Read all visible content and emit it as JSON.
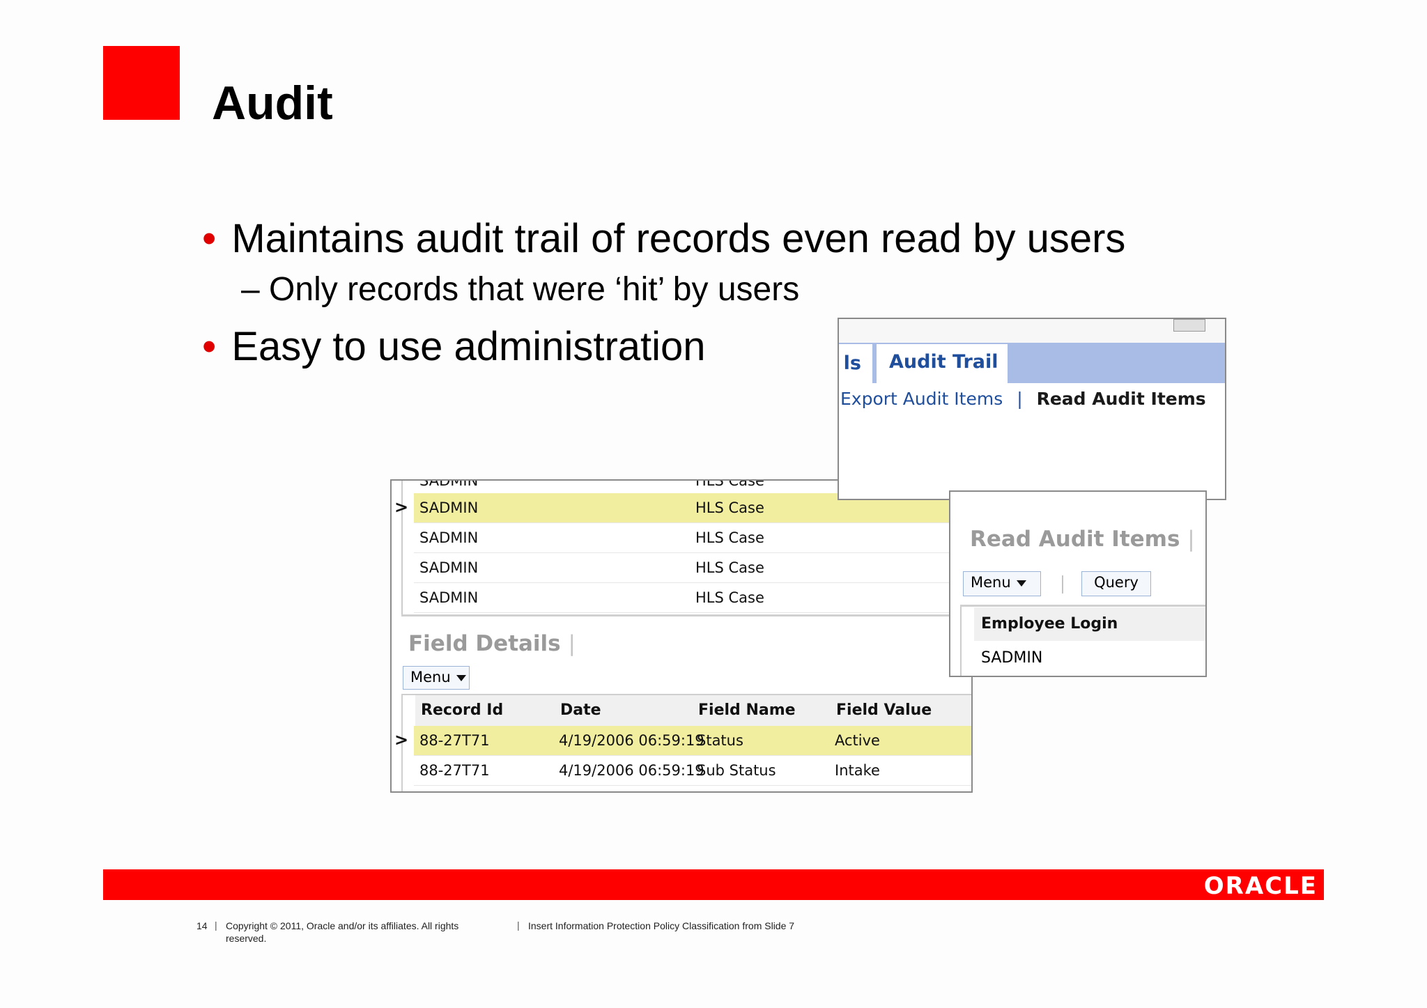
{
  "slide": {
    "title": "Audit",
    "bullets": [
      "Maintains audit trail of records even read by users",
      "Easy to use administration"
    ],
    "sub_bullet": "– Only records that were ‘hit’ by users",
    "bullet_char": "•"
  },
  "screens": {
    "top": {
      "tab_partial": "ls",
      "tab_active": "Audit Trail",
      "link_export": "Export Audit Items",
      "link_separator": "|",
      "link_read": "Read Audit Items"
    },
    "audit_list": {
      "rows": [
        {
          "user": "SADMIN",
          "object": "HLS Case"
        },
        {
          "user": "SADMIN",
          "object": "HLS Case"
        },
        {
          "user": "SADMIN",
          "object": "HLS Case"
        },
        {
          "user": "SADMIN",
          "object": "HLS Case"
        }
      ],
      "section_title": "Field Details",
      "section_sep": "|",
      "menu_label": "Menu",
      "columns": [
        "Record Id",
        "Date",
        "Field Name",
        "Field Value"
      ],
      "detail_rows": [
        {
          "record_id": "88-27T71",
          "date": "4/19/2006 06:59:19",
          "field_name": "Status",
          "field_value": "Active"
        },
        {
          "record_id": "88-27T71",
          "date": "4/19/2006 06:59:19",
          "field_name": "Sub Status",
          "field_value": "Intake"
        }
      ]
    },
    "read_audit": {
      "title": "Read Audit Items",
      "title_sep": "|",
      "menu_label": "Menu",
      "query_label": "Query",
      "column": "Employee Login",
      "value": "SADMIN"
    }
  },
  "footer": {
    "page_number": "14",
    "copyright_line1": "Copyright © 2011, Oracle and/or its affiliates. All rights",
    "copyright_line2": "reserved.",
    "classification": "Insert Information Protection Policy Classification from Slide 7",
    "logo_text": "ORACLE",
    "sep": "|"
  },
  "colors": {
    "brand_red": "#ff0000",
    "selected_row": "#f2eea0",
    "tab_bar": "#a8bce6",
    "link_blue": "#1f4e9c"
  }
}
